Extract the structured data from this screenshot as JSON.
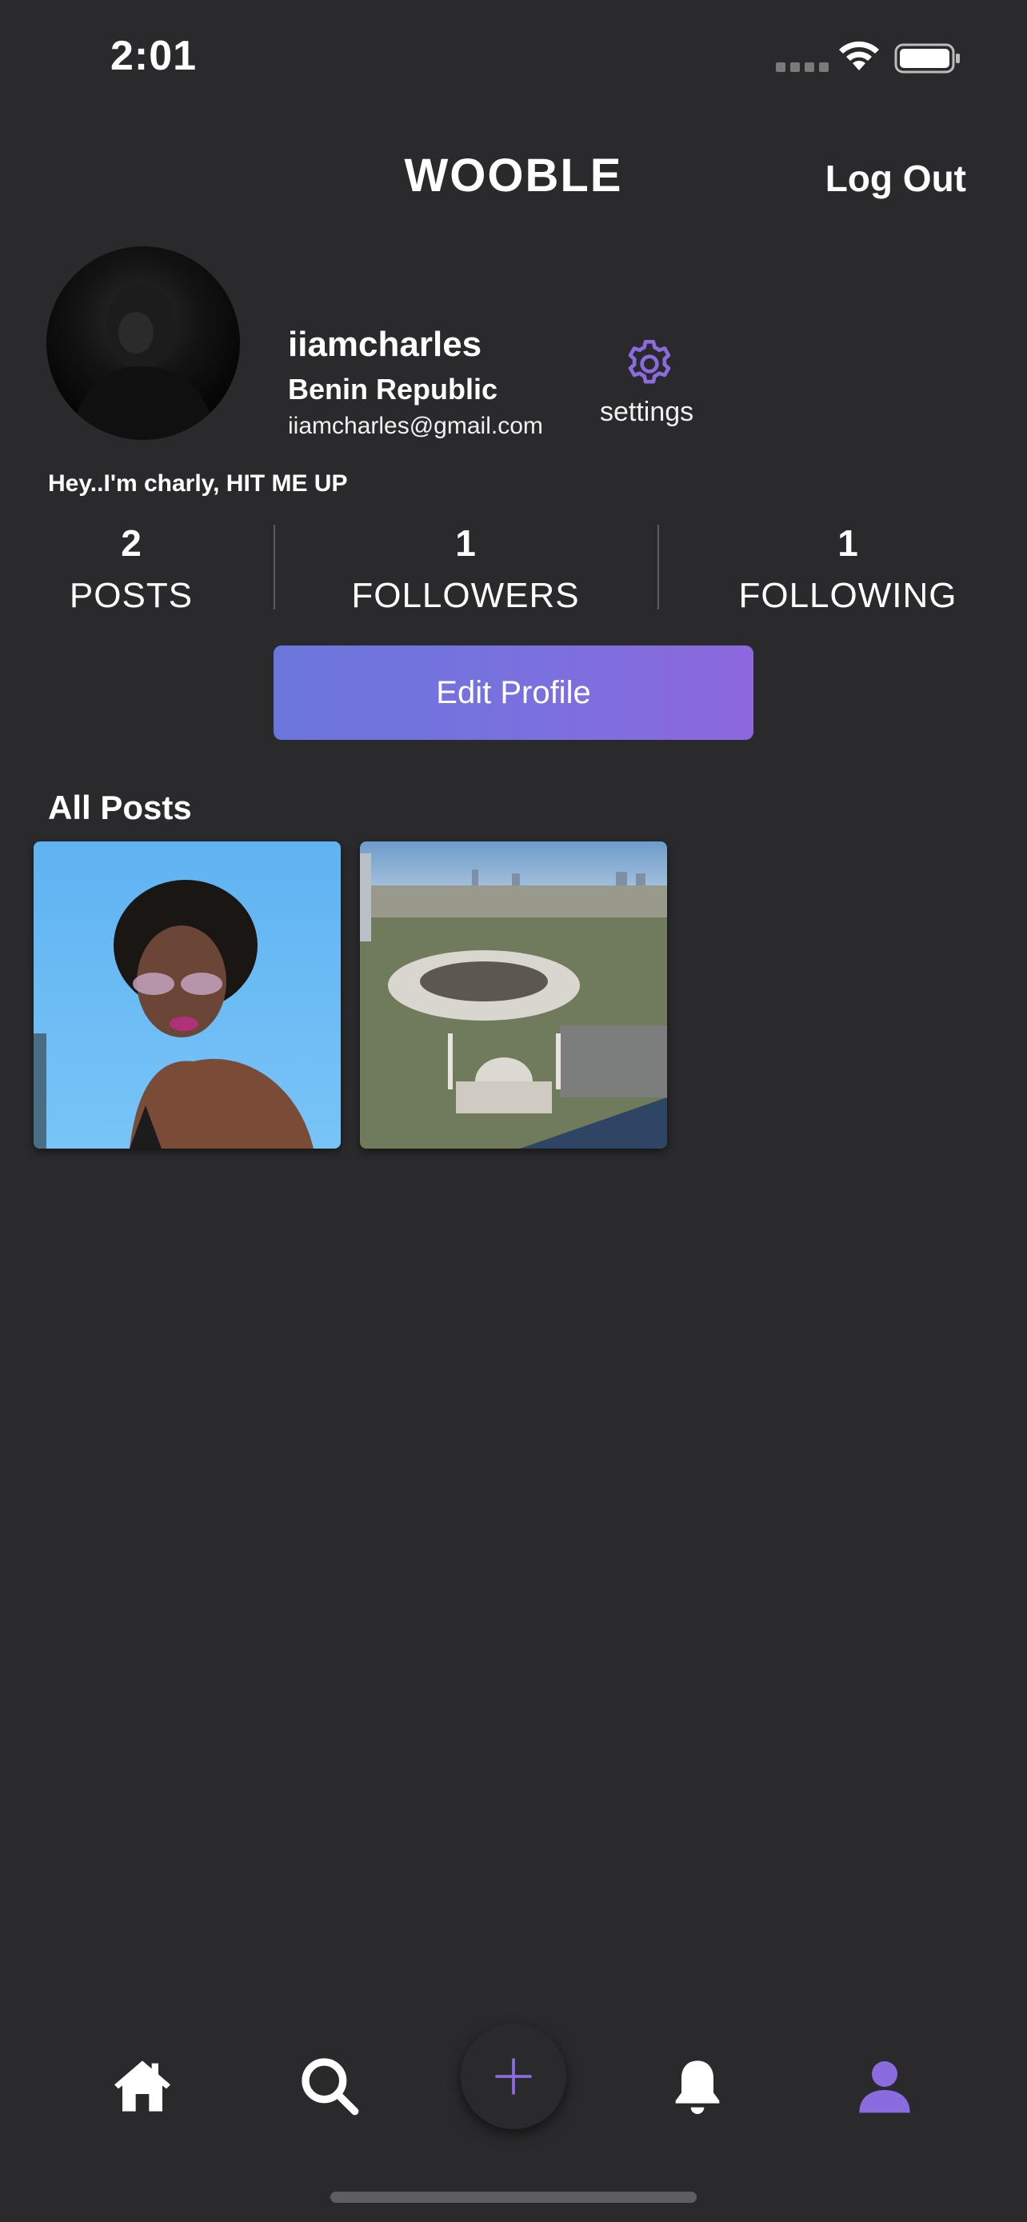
{
  "status_bar": {
    "time": "2:01"
  },
  "header": {
    "brand": "WOOBLE",
    "logout_label": "Log Out"
  },
  "profile": {
    "username": "iiamcharles",
    "location": "Benin Republic",
    "email": "iiamcharles@gmail.com",
    "settings_label": "settings",
    "bio": "Hey..I'm charly, HIT ME UP"
  },
  "stats": [
    {
      "value": "2",
      "label": "POSTS"
    },
    {
      "value": "1",
      "label": "FOLLOWERS"
    },
    {
      "value": "1",
      "label": "FOLLOWING"
    }
  ],
  "edit_profile_label": "Edit Profile",
  "posts_section": {
    "title": "All Posts"
  },
  "nav": {
    "items": [
      "home-icon",
      "search-icon",
      "add-icon",
      "bell-icon",
      "profile-icon"
    ],
    "active": "profile-icon"
  },
  "colors": {
    "background": "#2a292b",
    "accent": "#8a6be0",
    "button_gradient_start": "#6a76db",
    "button_gradient_end": "#8c67de"
  }
}
